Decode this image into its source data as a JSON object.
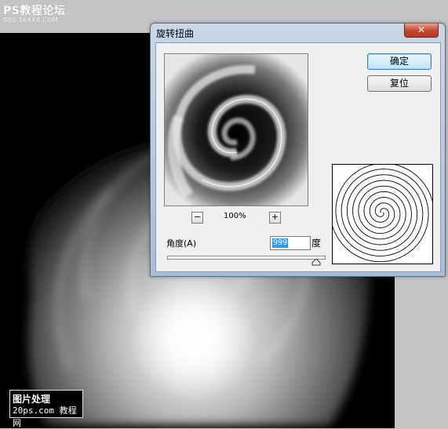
{
  "watermark": {
    "line1": "PS教程论坛",
    "line2": "BBS.16XX8.COM"
  },
  "stamp": {
    "line1": "图片处理",
    "line2": "20ps.com 教程网"
  },
  "dialog": {
    "title": "旋转扭曲",
    "close_icon": "✕",
    "ok_label": "确定",
    "reset_label": "复位",
    "zoom_minus": "−",
    "zoom_plus": "+",
    "zoom_level": "100%",
    "angle_label": "角度(A)",
    "angle_value": "999",
    "angle_unit": "度",
    "angle_slider_fraction": 0.95
  },
  "colors": {
    "titlebar": "#b9cbe2",
    "close": "#c5442c",
    "dialog_bg": "#f0f0f0"
  },
  "icons": {
    "close": "close-icon",
    "zoom_in": "plus-icon",
    "zoom_out": "minus-icon"
  }
}
